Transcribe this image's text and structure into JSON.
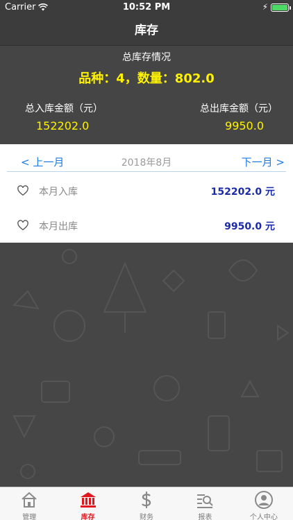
{
  "status_bar": {
    "carrier": "Carrier",
    "time": "10:52 PM"
  },
  "nav": {
    "title": "库存"
  },
  "summary": {
    "subtitle": "总库存情况",
    "main_stat": "品种：4，数量：802.0",
    "in_label": "总入库金额（元）",
    "out_label": "总出库金额（元）",
    "in_value": "152202.0",
    "out_value": "9950.0"
  },
  "month_panel": {
    "prev_label": "< 上一月",
    "current_month": "2018年8月",
    "next_label": "下一月 >",
    "rows": [
      {
        "label": "本月入库",
        "amount": "152202.0 元"
      },
      {
        "label": "本月出库",
        "amount": "9950.0 元"
      }
    ]
  },
  "tabs": [
    {
      "label": "管理",
      "icon": "house-icon",
      "active": false
    },
    {
      "label": "库存",
      "icon": "bank-icon",
      "active": true
    },
    {
      "label": "财务",
      "icon": "dollar-icon",
      "active": false
    },
    {
      "label": "报表",
      "icon": "report-search-icon",
      "active": false
    },
    {
      "label": "个人中心",
      "icon": "user-icon",
      "active": false
    }
  ],
  "colors": {
    "accent_yellow": "#fff200",
    "link_blue": "#1a7ae0",
    "amount_blue": "#1a2aa8",
    "active_tab_red": "#e1161e",
    "dark_background": "#464646"
  }
}
